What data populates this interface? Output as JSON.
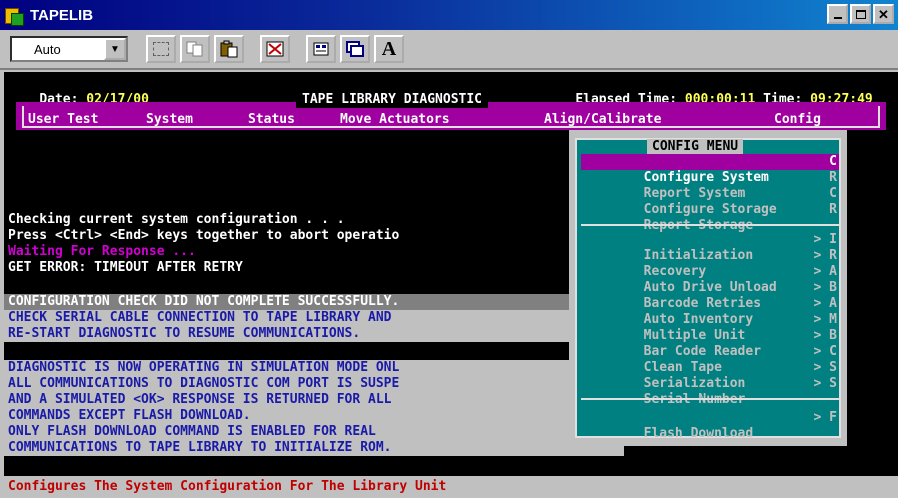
{
  "window": {
    "title": "TAPELIB"
  },
  "toolbar": {
    "font_combo": "Auto",
    "font_button": "A"
  },
  "console": {
    "date_label": "Date:",
    "date_value": "02/17/00",
    "elapsed_label": "Elapsed Time:",
    "elapsed_value": "000:00:11",
    "time_label": "Time:",
    "time_value": "09:27:49",
    "program_title": "TAPE LIBRARY DIAGNOSTIC",
    "menu": [
      "User Test",
      "System",
      "Status",
      "Move Actuators",
      "Align/Calibrate",
      "Config"
    ],
    "lines": [
      "Checking current system configuration . . .",
      "Press <Ctrl> <End> keys together to abort operatio",
      "Waiting For Response ...",
      "GET ERROR: TIMEOUT AFTER RETRY"
    ],
    "message1": [
      "CONFIGURATION CHECK DID NOT COMPLETE SUCCESSFULLY.",
      "CHECK SERIAL CABLE CONNECTION TO TAPE LIBRARY AND",
      "RE-START DIAGNOSTIC TO RESUME COMMUNICATIONS."
    ],
    "message2": [
      "DIAGNOSTIC IS NOW OPERATING IN SIMULATION MODE ONL",
      "ALL COMMUNICATIONS TO DIAGNOSTIC COM PORT IS SUSPE",
      "AND A SIMULATED <OK> RESPONSE IS RETURNED FOR ALL",
      "COMMANDS EXCEPT FLASH DOWNLOAD.",
      "ONLY FLASH DOWNLOAD COMMAND IS ENABLED FOR REAL",
      "COMMUNICATIONS TO TAPE LIBRARY TO INITIALIZE ROM."
    ],
    "status": "Configures The System Configuration For The Library Unit"
  },
  "config_menu": {
    "title": "CONFIG MENU",
    "items": [
      {
        "label": "Configure System",
        "key": "C",
        "selected": true
      },
      {
        "label": "Report System",
        "key": "R"
      },
      {
        "label": "Configure Storage",
        "key": "C"
      },
      {
        "label": "Report Storage",
        "key": "R"
      },
      {
        "label": "Initialization",
        "key": "> I"
      },
      {
        "label": "Recovery",
        "key": "> R"
      },
      {
        "label": "Auto Drive Unload",
        "key": "> A"
      },
      {
        "label": "Barcode Retries",
        "key": "> B"
      },
      {
        "label": "Auto Inventory",
        "key": "> A"
      },
      {
        "label": "Multiple Unit",
        "key": "> M"
      },
      {
        "label": "Bar Code Reader",
        "key": "> B"
      },
      {
        "label": "Clean Tape",
        "key": "> C"
      },
      {
        "label": "Serialization",
        "key": "> S"
      },
      {
        "label": "Serial Number",
        "key": "> S"
      },
      {
        "label": "Flash Download",
        "key": "> F"
      }
    ]
  },
  "colors": {
    "console_bg": "#000000",
    "menu_band": "#a000a0",
    "popup_bg": "#008080",
    "message_text": "#1a1aa8",
    "status_text": "#c00000"
  }
}
